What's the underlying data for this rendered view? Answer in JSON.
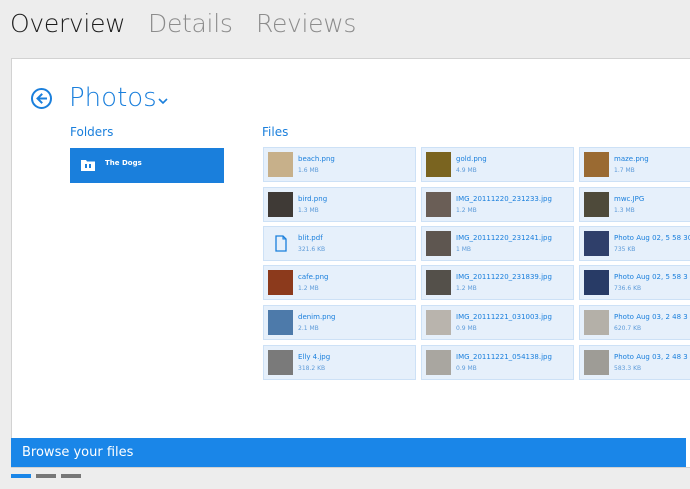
{
  "tabs": [
    {
      "label": "Overview",
      "active": true
    },
    {
      "label": "Details",
      "active": false
    },
    {
      "label": "Reviews",
      "active": false
    }
  ],
  "header": {
    "title": "Photos",
    "back_icon": "back-arrow-circle-icon",
    "dropdown_icon": "chevron-down-icon"
  },
  "folders": {
    "label": "Folders",
    "items": [
      {
        "name": "The Dogs",
        "icon": "folder-icon"
      }
    ]
  },
  "files": {
    "label": "Files",
    "items": [
      {
        "name": "beach.png",
        "size": "1.6 MB",
        "thumb_color": "#c7b08a"
      },
      {
        "name": "gold.png",
        "size": "4.9 MB",
        "thumb_color": "#7a6420"
      },
      {
        "name": "maze.png",
        "size": "1.7 MB",
        "thumb_color": "#9a6a32"
      },
      {
        "name": "bird.png",
        "size": "1.3 MB",
        "thumb_color": "#3f3a36"
      },
      {
        "name": "IMG_20111220_231233.jpg",
        "size": "1.2 MB",
        "thumb_color": "#6a5e56"
      },
      {
        "name": "mwc.JPG",
        "size": "1.3 MB",
        "thumb_color": "#4e4a3a"
      },
      {
        "name": "blit.pdf",
        "size": "321.6 KB",
        "thumb_color": "doc"
      },
      {
        "name": "IMG_20111220_231241.jpg",
        "size": "1 MB",
        "thumb_color": "#5e5650"
      },
      {
        "name": "Photo Aug 02, 5 58 30",
        "size": "735 KB",
        "thumb_color": "#2f3f6a"
      },
      {
        "name": "cafe.png",
        "size": "1.2 MB",
        "thumb_color": "#8c3a1c"
      },
      {
        "name": "IMG_20111220_231839.jpg",
        "size": "1.2 MB",
        "thumb_color": "#54504a"
      },
      {
        "name": "Photo Aug 02, 5 58 3",
        "size": "736.6 KB",
        "thumb_color": "#283b66"
      },
      {
        "name": "denim.png",
        "size": "2.1 MB",
        "thumb_color": "#4d7aaa"
      },
      {
        "name": "IMG_20111221_031003.jpg",
        "size": "0.9 MB",
        "thumb_color": "#b9b4ad"
      },
      {
        "name": "Photo Aug 03, 2 48 3",
        "size": "620.7 KB",
        "thumb_color": "#b4b0a8"
      },
      {
        "name": "Elly 4.jpg",
        "size": "318.2 KB",
        "thumb_color": "#7a7a7a"
      },
      {
        "name": "IMG_20111221_054138.jpg",
        "size": "0.9 MB",
        "thumb_color": "#a9a6a0"
      },
      {
        "name": "Photo Aug 03, 2 48 3",
        "size": "583.3 KB",
        "thumb_color": "#9e9c96"
      }
    ]
  },
  "caption": "Browse your files",
  "pager": {
    "count": 3,
    "active_index": 0
  }
}
